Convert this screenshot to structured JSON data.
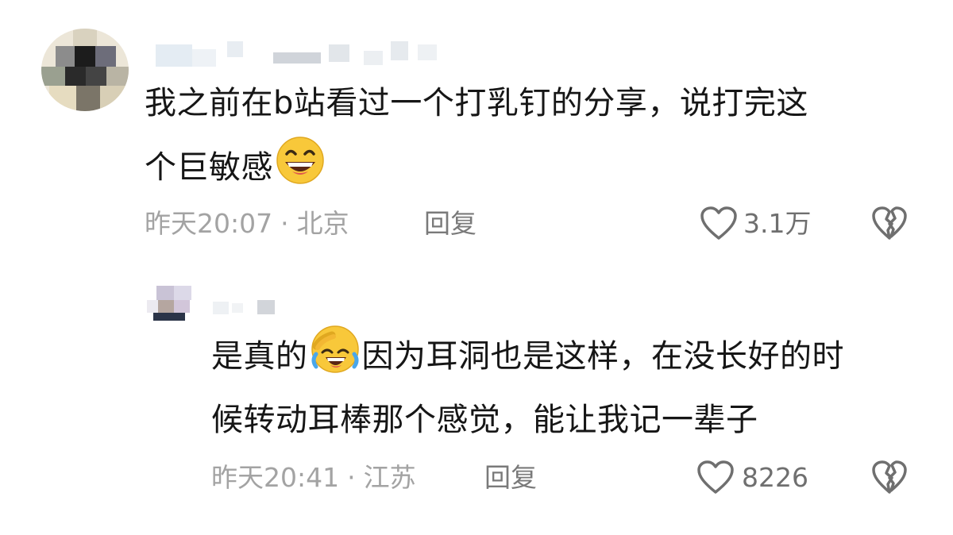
{
  "comments": [
    {
      "text_line1": "我之前在b站看过一个打乳钉的分享，说打完这",
      "text_line2": "个巨敏感",
      "emoji": "grinning-sweat-emoji",
      "time": "昨天20:07",
      "location": "北京",
      "reply_label": "回复",
      "likes": "3.1万",
      "like_icon": "heart-outline-icon",
      "dislike_icon": "broken-heart-icon"
    },
    {
      "text_part1": "是真的",
      "text_part2": "因为耳洞也是这样，在没长好的时",
      "text_line2": "候转动耳棒那个感觉，能让我记一辈子",
      "emoji": "rolling-laughing-emoji",
      "time": "昨天20:41",
      "location": "江苏",
      "reply_label": "回复",
      "likes": "8226",
      "like_icon": "heart-outline-icon",
      "dislike_icon": "broken-heart-icon"
    }
  ],
  "meta_separator": "·",
  "colors": {
    "text": "#161616",
    "meta": "#a3a3a3",
    "icon": "#6f6f6f",
    "emoji_yellow": "#f8c83a"
  }
}
